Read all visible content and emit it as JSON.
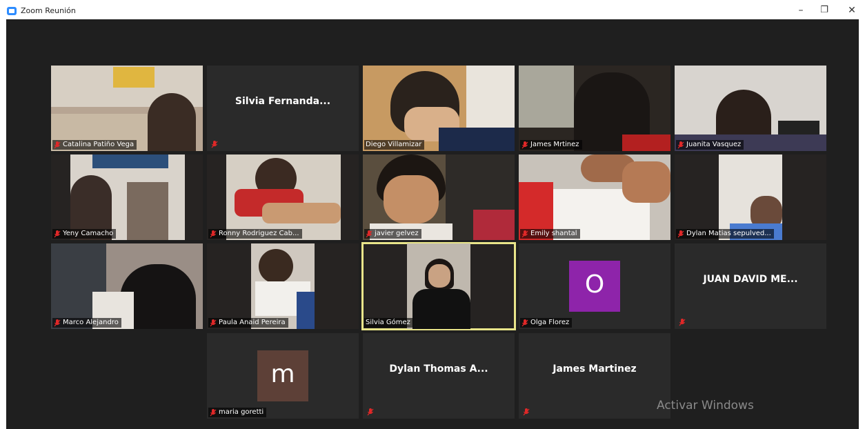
{
  "window": {
    "title": "Zoom Reunión",
    "minimize_glyph": "–",
    "restore_glyph": "❐",
    "close_glyph": "✕"
  },
  "participants": [
    {
      "name": "Catalina Patiño Vega",
      "muted": true,
      "video": true
    },
    {
      "name": "Silvia  Fernanda...",
      "muted": true,
      "video": false
    },
    {
      "name": "Diego Villamizar",
      "muted": false,
      "video": true
    },
    {
      "name": "James Mrtinez",
      "muted": true,
      "video": true
    },
    {
      "name": "Juanita Vasquez",
      "muted": true,
      "video": true
    },
    {
      "name": "Yeny Camacho",
      "muted": true,
      "video": true
    },
    {
      "name": "Ronny Rodriguez Cab...",
      "muted": true,
      "video": true
    },
    {
      "name": "javier gelvez",
      "muted": true,
      "video": true
    },
    {
      "name": "Emily shantal",
      "muted": true,
      "video": true
    },
    {
      "name": "Dylan Matias sepulved...",
      "muted": true,
      "video": true
    },
    {
      "name": "Marco Alejandro",
      "muted": true,
      "video": true
    },
    {
      "name": "Paula Anaid Pereira",
      "muted": true,
      "video": true
    },
    {
      "name": "Silvia Gómez",
      "muted": false,
      "video": true,
      "active_speaker": true
    },
    {
      "name": "Olga Florez",
      "muted": true,
      "video": false,
      "avatar_letter": "O",
      "avatar_color": "#8e24aa"
    },
    {
      "name": "JUAN DAVID ME...",
      "muted": true,
      "video": false
    },
    {
      "name": "maria goretti",
      "muted": true,
      "video": false,
      "avatar_letter": "m",
      "avatar_color": "#5d4037"
    },
    {
      "name": "Dylan Thomas A...",
      "muted": true,
      "video": false
    },
    {
      "name": "James Martinez",
      "muted": true,
      "video": false
    }
  ],
  "colors": {
    "background": "#1f1f1f",
    "tile": "#2a2a2a",
    "active_border": "#e9e58a",
    "mute_red": "#e02828"
  },
  "watermark": "Activar Windows"
}
